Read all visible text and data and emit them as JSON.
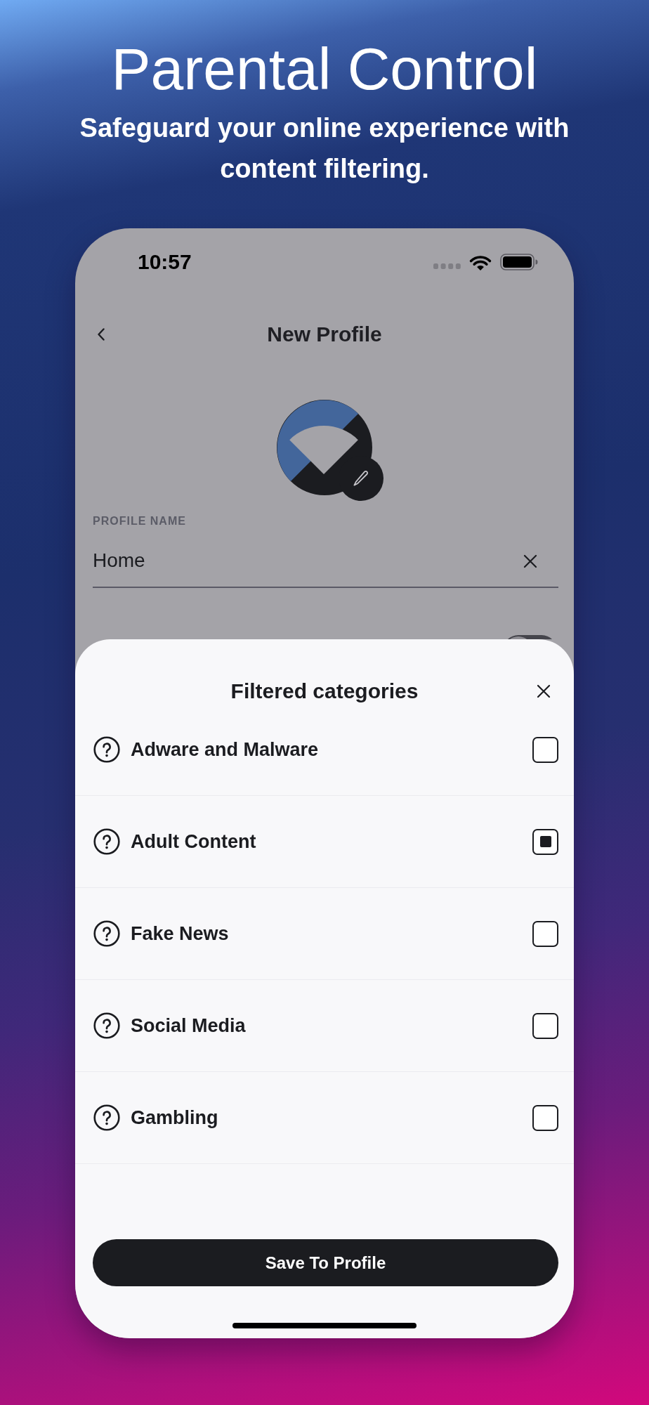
{
  "hero": {
    "title": "Parental Control",
    "subtitle": "Safeguard your online experience with content filtering."
  },
  "status_bar": {
    "time": "10:57"
  },
  "nav": {
    "title": "New Profile"
  },
  "profile_name": {
    "label": "PROFILE NAME",
    "value": "Home"
  },
  "settings_toggle": {
    "on": false
  },
  "sheet": {
    "title": "Filtered categories",
    "categories": [
      {
        "label": "Adware and Malware",
        "checked": false
      },
      {
        "label": "Adult Content",
        "checked": true
      },
      {
        "label": "Fake News",
        "checked": false
      },
      {
        "label": "Social Media",
        "checked": false
      },
      {
        "label": "Gambling",
        "checked": false
      }
    ],
    "save_button": "Save To Profile"
  }
}
